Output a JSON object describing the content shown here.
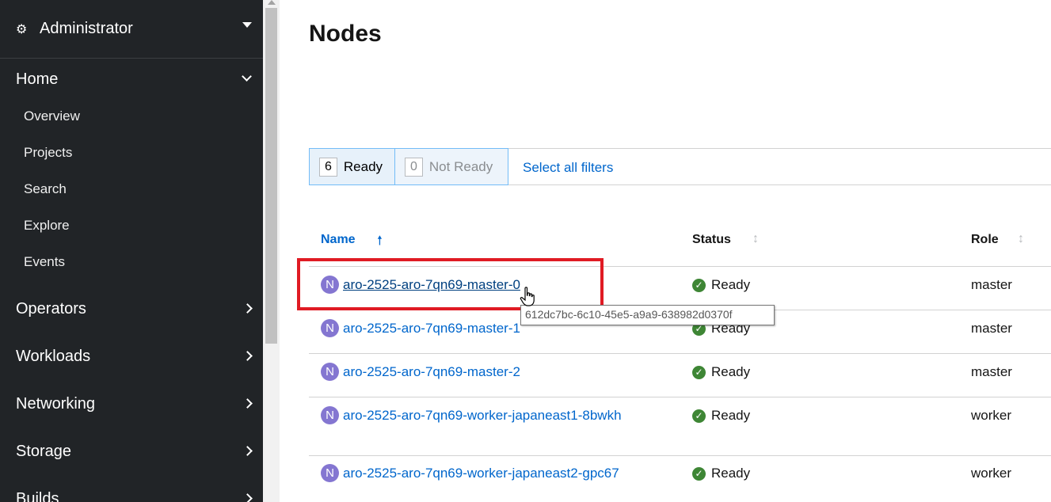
{
  "sidebar": {
    "perspective": "Administrator",
    "sections": [
      {
        "label": "Home",
        "expanded": true,
        "items": [
          "Overview",
          "Projects",
          "Search",
          "Explore",
          "Events"
        ]
      },
      {
        "label": "Operators",
        "expanded": false
      },
      {
        "label": "Workloads",
        "expanded": false
      },
      {
        "label": "Networking",
        "expanded": false
      },
      {
        "label": "Storage",
        "expanded": false
      },
      {
        "label": "Builds",
        "expanded": false
      }
    ]
  },
  "page": {
    "title": "Nodes",
    "filters": [
      {
        "count": "6",
        "label": "Ready"
      },
      {
        "count": "0",
        "label": "Not Ready"
      }
    ],
    "select_all": "Select all filters",
    "columns": {
      "name": "Name",
      "status": "Status",
      "role": "Role"
    },
    "badge_letter": "N",
    "rows": [
      {
        "name": "aro-2525-aro-7qn69-master-0",
        "status": "Ready",
        "role": "master"
      },
      {
        "name": "aro-2525-aro-7qn69-master-1",
        "status": "Ready",
        "role": "master"
      },
      {
        "name": "aro-2525-aro-7qn69-master-2",
        "status": "Ready",
        "role": "master"
      },
      {
        "name": "aro-2525-aro-7qn69-worker-japaneast1-8bwkh",
        "status": "Ready",
        "role": "worker"
      },
      {
        "name": "aro-2525-aro-7qn69-worker-japaneast2-gpc67",
        "status": "Ready",
        "role": "worker"
      }
    ],
    "tooltip": "612dc7bc-6c10-45e5-a9a9-638982d0370f"
  },
  "colors": {
    "sidebar_bg": "#212427",
    "link": "#0066cc",
    "badge": "#8476d1",
    "ready": "#3e8635",
    "highlight": "#e01b24"
  },
  "icons": {
    "perspective": "cogs-icon",
    "sort_asc": "arrow-up-icon",
    "sort": "sort-icon",
    "status": "check-circle-icon"
  }
}
